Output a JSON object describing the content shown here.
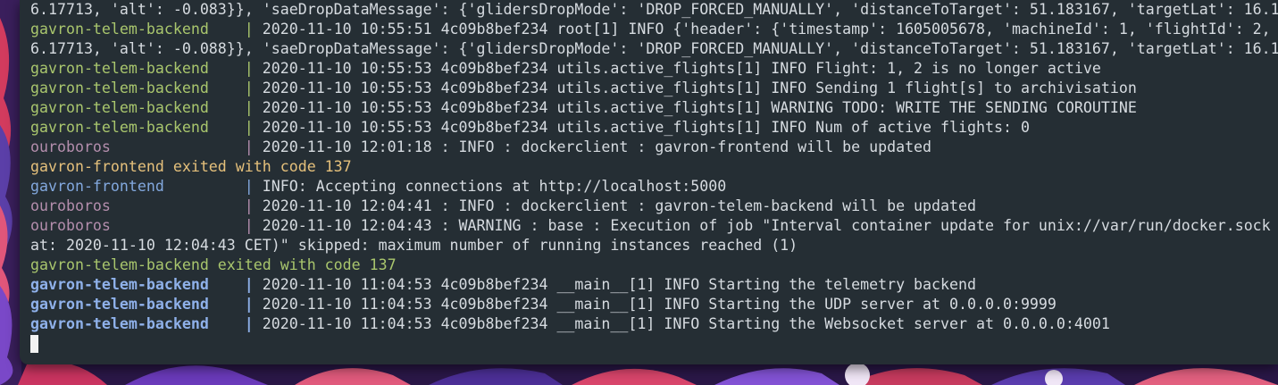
{
  "terminal": {
    "lines": [
      {
        "parts": [
          {
            "text": "6.17713, 'alt': -0.083}}, 'saeDropDataMessage': {'glidersDropMode': 'DROP_FORCED_MANUALLY', 'distanceToTarget': 51.183167, 'targetLat': 16.1",
            "cls": "c-white"
          }
        ]
      },
      {
        "parts": [
          {
            "text": "gavron-telem-backend    ",
            "cls": "c-green"
          },
          {
            "text": "| ",
            "cls": "c-green"
          },
          {
            "text": "2020-11-10 10:55:51 4c09b8bef234 root[1] INFO {'header': {'timestamp': 1605005678, 'machineId': 1, 'flightId': 2,",
            "cls": "c-white"
          }
        ]
      },
      {
        "parts": [
          {
            "text": "6.17713, 'alt': -0.088}}, 'saeDropDataMessage': {'glidersDropMode': 'DROP_FORCED_MANUALLY', 'distanceToTarget': 51.183167, 'targetLat': 16.1",
            "cls": "c-white"
          }
        ]
      },
      {
        "parts": [
          {
            "text": "gavron-telem-backend    ",
            "cls": "c-green"
          },
          {
            "text": "| ",
            "cls": "c-green"
          },
          {
            "text": "2020-11-10 10:55:53 4c09b8bef234 utils.active_flights[1] INFO Flight: 1, 2 is no longer active",
            "cls": "c-white"
          }
        ]
      },
      {
        "parts": [
          {
            "text": "gavron-telem-backend    ",
            "cls": "c-green"
          },
          {
            "text": "| ",
            "cls": "c-green"
          },
          {
            "text": "2020-11-10 10:55:53 4c09b8bef234 utils.active_flights[1] INFO Sending 1 flight[s] to archivisation",
            "cls": "c-white"
          }
        ]
      },
      {
        "parts": [
          {
            "text": "gavron-telem-backend    ",
            "cls": "c-green"
          },
          {
            "text": "| ",
            "cls": "c-green"
          },
          {
            "text": "2020-11-10 10:55:53 4c09b8bef234 utils.active_flights[1] WARNING TODO: WRITE THE SENDING COROUTINE",
            "cls": "c-white"
          }
        ]
      },
      {
        "parts": [
          {
            "text": "gavron-telem-backend    ",
            "cls": "c-green"
          },
          {
            "text": "| ",
            "cls": "c-green"
          },
          {
            "text": "2020-11-10 10:55:53 4c09b8bef234 utils.active_flights[1] INFO Num of active flights: 0",
            "cls": "c-white"
          }
        ]
      },
      {
        "parts": [
          {
            "text": "ouroboros               ",
            "cls": "c-purple"
          },
          {
            "text": "| ",
            "cls": "c-purple"
          },
          {
            "text": "2020-11-10 12:01:18 : INFO : dockerclient : gavron-frontend will be updated",
            "cls": "c-white"
          }
        ]
      },
      {
        "parts": [
          {
            "text": "gavron-frontend exited with code 137",
            "cls": "c-yellow"
          }
        ]
      },
      {
        "parts": [
          {
            "text": "gavron-frontend         ",
            "cls": "c-blue"
          },
          {
            "text": "| ",
            "cls": "c-blue"
          },
          {
            "text": "INFO: Accepting connections at http://localhost:5000",
            "cls": "c-white"
          }
        ]
      },
      {
        "parts": [
          {
            "text": "ouroboros               ",
            "cls": "c-purple"
          },
          {
            "text": "| ",
            "cls": "c-purple"
          },
          {
            "text": "2020-11-10 12:04:41 : INFO : dockerclient : gavron-telem-backend will be updated",
            "cls": "c-white"
          }
        ]
      },
      {
        "parts": [
          {
            "text": "ouroboros               ",
            "cls": "c-purple"
          },
          {
            "text": "| ",
            "cls": "c-purple"
          },
          {
            "text": "2020-11-10 12:04:43 : WARNING : base : Execution of job \"Interval container update for unix://var/run/docker.sock",
            "cls": "c-white"
          }
        ]
      },
      {
        "parts": [
          {
            "text": "at: 2020-11-10 12:04:43 CET)\" skipped: maximum number of running instances reached (1)",
            "cls": "c-white"
          }
        ]
      },
      {
        "parts": [
          {
            "text": "gavron-telem-backend exited with code 137",
            "cls": "c-green"
          }
        ]
      },
      {
        "parts": [
          {
            "text": "gavron-telem-backend    ",
            "cls": "c-blue-bold"
          },
          {
            "text": "| ",
            "cls": "c-blue-bold"
          },
          {
            "text": "2020-11-10 11:04:53 4c09b8bef234 __main__[1] INFO Starting the telemetry backend",
            "cls": "c-white"
          }
        ]
      },
      {
        "parts": [
          {
            "text": "gavron-telem-backend    ",
            "cls": "c-blue-bold"
          },
          {
            "text": "| ",
            "cls": "c-blue-bold"
          },
          {
            "text": "2020-11-10 11:04:53 4c09b8bef234 __main__[1] INFO Starting the UDP server at 0.0.0.0:9999",
            "cls": "c-white"
          }
        ]
      },
      {
        "parts": [
          {
            "text": "gavron-telem-backend    ",
            "cls": "c-blue-bold"
          },
          {
            "text": "| ",
            "cls": "c-blue-bold"
          },
          {
            "text": "2020-11-10 11:04:53 4c09b8bef234 __main__[1] INFO Starting the Websocket server at 0.0.0.0:4001",
            "cls": "c-white"
          }
        ]
      }
    ]
  },
  "colors": {
    "terminal_bg": "#252e34",
    "green": "#a9c66d",
    "purple": "#b48ead",
    "yellow": "#e5c07b",
    "blue": "#82a8de",
    "text": "#d6dbe0"
  }
}
